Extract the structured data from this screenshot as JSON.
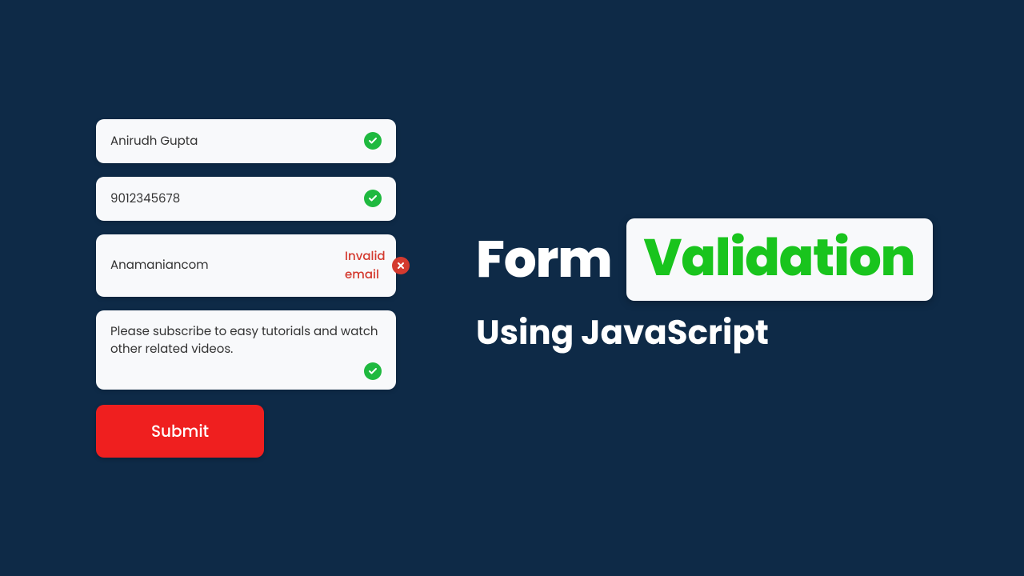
{
  "form": {
    "name": {
      "value": "Anirudh Gupta",
      "valid": true
    },
    "phone": {
      "value": "9012345678",
      "valid": true
    },
    "email": {
      "value": "Anamaniancom",
      "valid": false,
      "error": "Invalid email"
    },
    "message": {
      "value": "Please subscribe to easy tutorials and watch other related videos.",
      "valid": true
    },
    "submit_label": "Submit"
  },
  "heading": {
    "word1": "Form",
    "word2": "Validation",
    "subtitle": "Using JavaScript"
  },
  "colors": {
    "background": "#0e2a47",
    "success": "#1fb93f",
    "error": "#d43a2f",
    "submit": "#ef1f1f",
    "highlight_text": "#19c41d",
    "field_bg": "#f8f9fb"
  }
}
